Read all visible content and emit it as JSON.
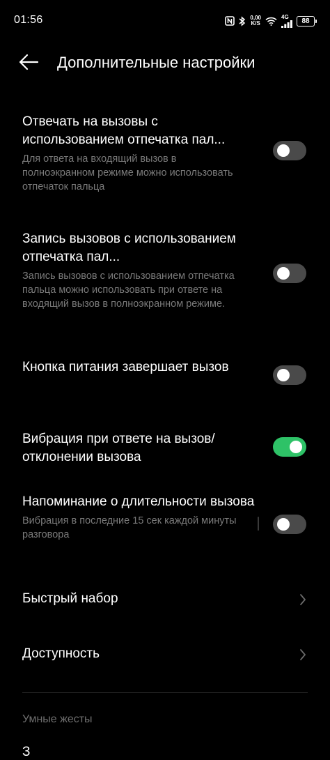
{
  "status_bar": {
    "time": "01:56",
    "net_speed_value": "0,00",
    "net_speed_unit": "K/S",
    "network_type": "4G",
    "battery_level": "88"
  },
  "header": {
    "title": "Дополнительные настройки"
  },
  "settings": [
    {
      "title": "Отвечать на вызовы с использованием отпечатка пал...",
      "description": "Для ответа на входящий вызов в полноэкранном режиме можно использовать отпечаток пальца",
      "enabled": false
    },
    {
      "title": "Запись вызовов с использованием отпечатка пал...",
      "description": "Запись вызовов с использованием отпечатка пальца можно использовать при ответе на входящий вызов в полноэкранном режиме.",
      "enabled": false
    },
    {
      "title": "Кнопка питания завершает вызов",
      "description": "",
      "enabled": false
    },
    {
      "title": "Вибрация при ответе на вызов/ отклонении вызова",
      "description": "",
      "enabled": true
    },
    {
      "title": "Напоминание о длительности вызова",
      "description": "Вибрация в последние 15 сек каждой минуты разговора",
      "enabled": false
    }
  ],
  "nav_items": [
    {
      "label": "Быстрый набор"
    },
    {
      "label": "Доступность"
    }
  ],
  "section": {
    "header": "Умные жесты",
    "first_item_partial": "З"
  },
  "colors": {
    "background": "#000000",
    "toggle_on": "#2ec267",
    "toggle_off": "#4a4a4a",
    "secondary_text": "#7a7a7a"
  }
}
